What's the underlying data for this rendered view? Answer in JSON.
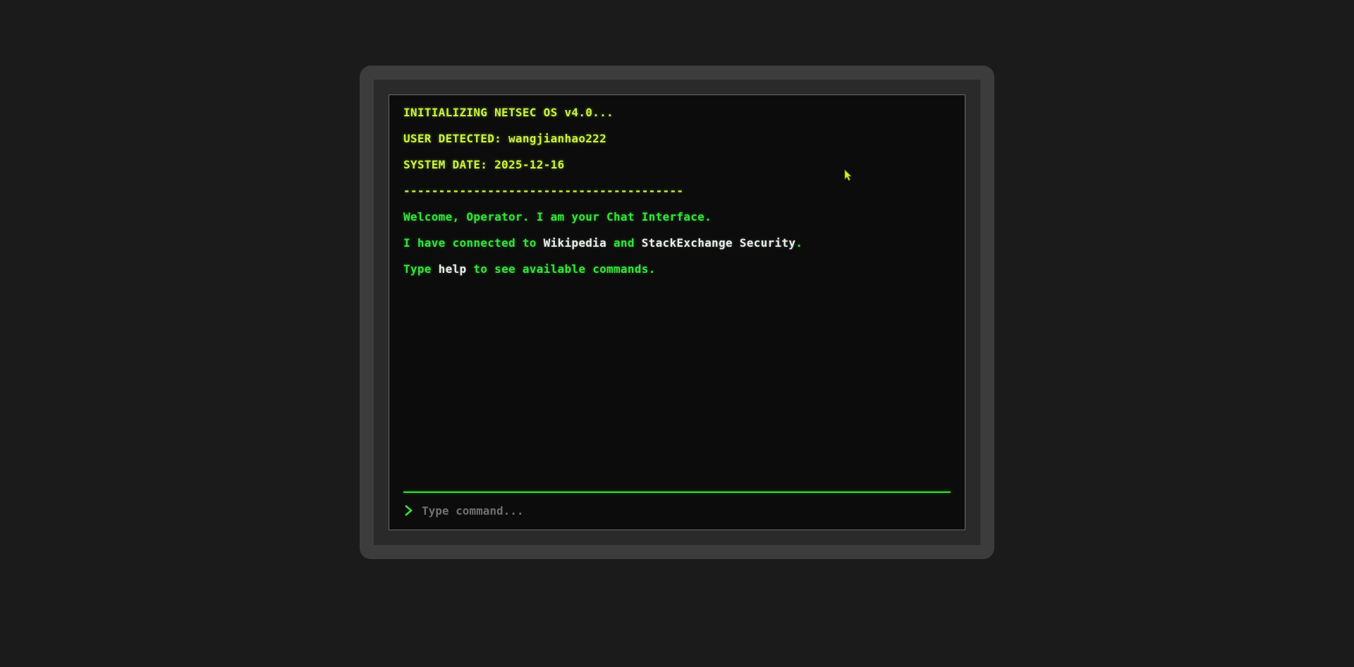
{
  "terminal": {
    "boot_lines": [
      "INITIALIZING NETSEC OS v4.0...",
      "USER DETECTED: wangjianhao222",
      "SYSTEM DATE: 2025-12-16",
      "----------------------------------------"
    ],
    "welcome": "Welcome, Operator. I am your Chat Interface.",
    "connected": {
      "prefix": "I have connected to ",
      "source1": "Wikipedia",
      "join": " and ",
      "source2": "StackExchange Security",
      "suffix": "."
    },
    "help_hint": {
      "prefix": "Type ",
      "command": "help",
      "suffix": " to see available commands."
    }
  },
  "input": {
    "placeholder": "Type command...",
    "value": ""
  },
  "colors": {
    "system_text": "#c8f53c",
    "message_text": "#37e23c",
    "highlight_text": "#e8f0e8",
    "screen_bg": "#0c0c0c",
    "page_bg": "#1b1b1b"
  },
  "icons": {
    "prompt": "chevron-right-icon",
    "pointer": "mouse-cursor-icon"
  }
}
